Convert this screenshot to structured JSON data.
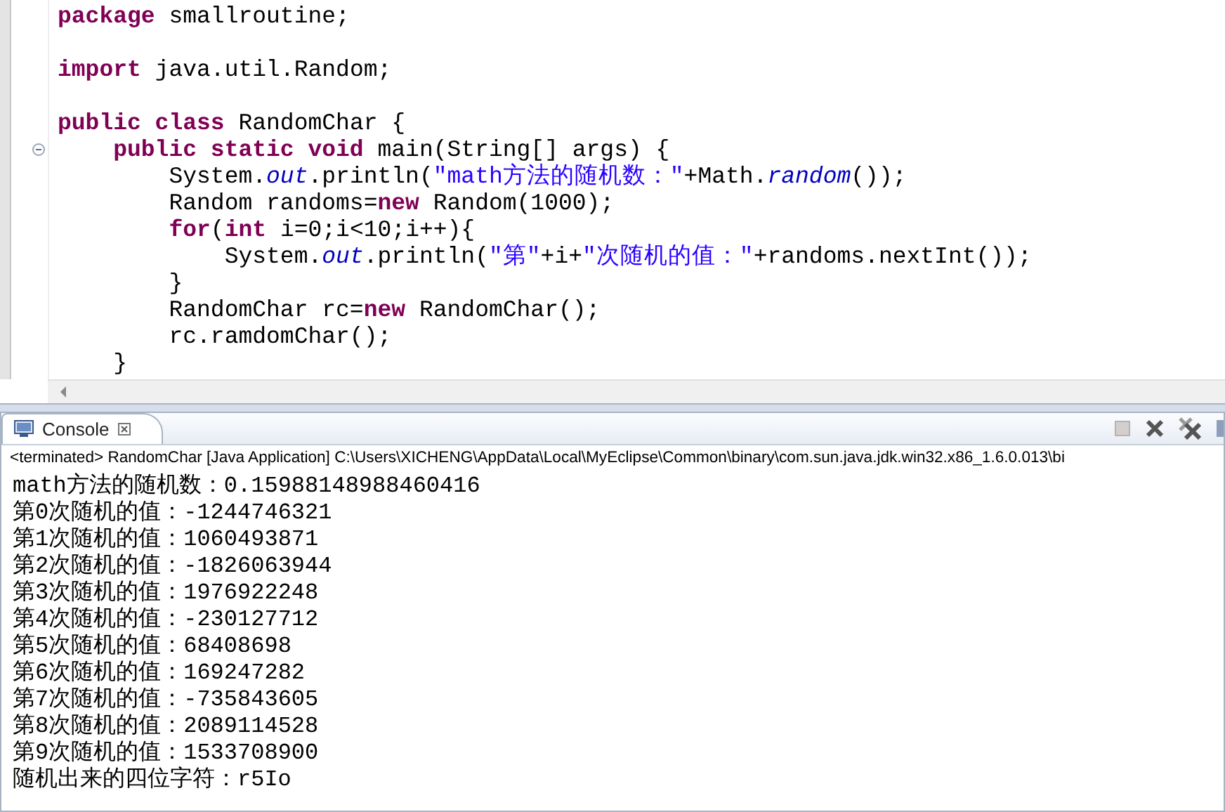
{
  "editor": {
    "lines": [
      {
        "fold_marker": false,
        "tokens": [
          {
            "kind": "keyword",
            "text": "package"
          },
          {
            "kind": "plain",
            "text": " smallroutine;"
          }
        ]
      },
      {
        "fold_marker": false
      },
      {
        "fold_marker": false,
        "tokens": [
          {
            "kind": "keyword",
            "text": "import"
          },
          {
            "kind": "plain",
            "text": " java.util.Random;"
          }
        ]
      },
      {
        "fold_marker": false
      },
      {
        "fold_marker": false,
        "tokens": [
          {
            "kind": "keyword",
            "text": "public class"
          },
          {
            "kind": "plain",
            "text": " RandomChar {"
          }
        ]
      },
      {
        "fold_marker": true,
        "tokens": [
          {
            "kind": "keyword",
            "text": "    public static void"
          },
          {
            "kind": "plain",
            "text": " main(String[] args) {"
          }
        ]
      },
      {
        "fold_marker": false,
        "tokens": [
          {
            "kind": "plain",
            "text": "        System."
          },
          {
            "kind": "field",
            "text": "out"
          },
          {
            "kind": "plain",
            "text": ".println("
          },
          {
            "kind": "string",
            "text": "\"math方法的随机数：\""
          },
          {
            "kind": "plain",
            "text": "+Math."
          },
          {
            "kind": "static_method",
            "text": "random"
          },
          {
            "kind": "plain",
            "text": "());"
          }
        ]
      },
      {
        "fold_marker": false,
        "tokens": [
          {
            "kind": "plain",
            "text": "        Random randoms="
          },
          {
            "kind": "keyword",
            "text": "new"
          },
          {
            "kind": "plain",
            "text": " Random(1000);"
          }
        ]
      },
      {
        "fold_marker": false,
        "tokens": [
          {
            "kind": "keyword",
            "text": "        for"
          },
          {
            "kind": "plain",
            "text": "("
          },
          {
            "kind": "keyword",
            "text": "int"
          },
          {
            "kind": "plain",
            "text": " i=0;i<10;i++){"
          }
        ]
      },
      {
        "fold_marker": false,
        "tokens": [
          {
            "kind": "plain",
            "text": "            System."
          },
          {
            "kind": "field",
            "text": "out"
          },
          {
            "kind": "plain",
            "text": ".println("
          },
          {
            "kind": "string",
            "text": "\"第\""
          },
          {
            "kind": "plain",
            "text": "+i+"
          },
          {
            "kind": "string",
            "text": "\"次随机的值：\""
          },
          {
            "kind": "plain",
            "text": "+randoms.nextInt());"
          }
        ]
      },
      {
        "fold_marker": false,
        "tokens": [
          {
            "kind": "plain",
            "text": "        }"
          }
        ]
      },
      {
        "fold_marker": false,
        "tokens": [
          {
            "kind": "plain",
            "text": "        RandomChar rc="
          },
          {
            "kind": "keyword",
            "text": "new"
          },
          {
            "kind": "plain",
            "text": " RandomChar();"
          }
        ]
      },
      {
        "fold_marker": false,
        "tokens": [
          {
            "kind": "plain",
            "text": "        rc.ramdomChar();"
          }
        ]
      },
      {
        "fold_marker": false,
        "tokens": [
          {
            "kind": "plain",
            "text": "    }"
          }
        ]
      }
    ]
  },
  "console": {
    "tab": {
      "label": "Console",
      "selected": true
    },
    "status": "<terminated> RandomChar [Java Application] C:\\Users\\XICHENG\\AppData\\Local\\MyEclipse\\Common\\binary\\com.sun.java.jdk.win32.x86_1.6.0.013\\bi",
    "output": [
      "math方法的随机数：0.15988148988460416",
      "第0次随机的值：-1244746321",
      "第1次随机的值：1060493871",
      "第2次随机的值：-1826063944",
      "第3次随机的值：1976922248",
      "第4次随机的值：-230127712",
      "第5次随机的值：68408698",
      "第6次随机的值：169247282",
      "第7次随机的值：-735843605",
      "第8次随机的值：2089114528",
      "第9次随机的值：1533708900",
      "随机出来的四位字符：r5Io"
    ]
  }
}
